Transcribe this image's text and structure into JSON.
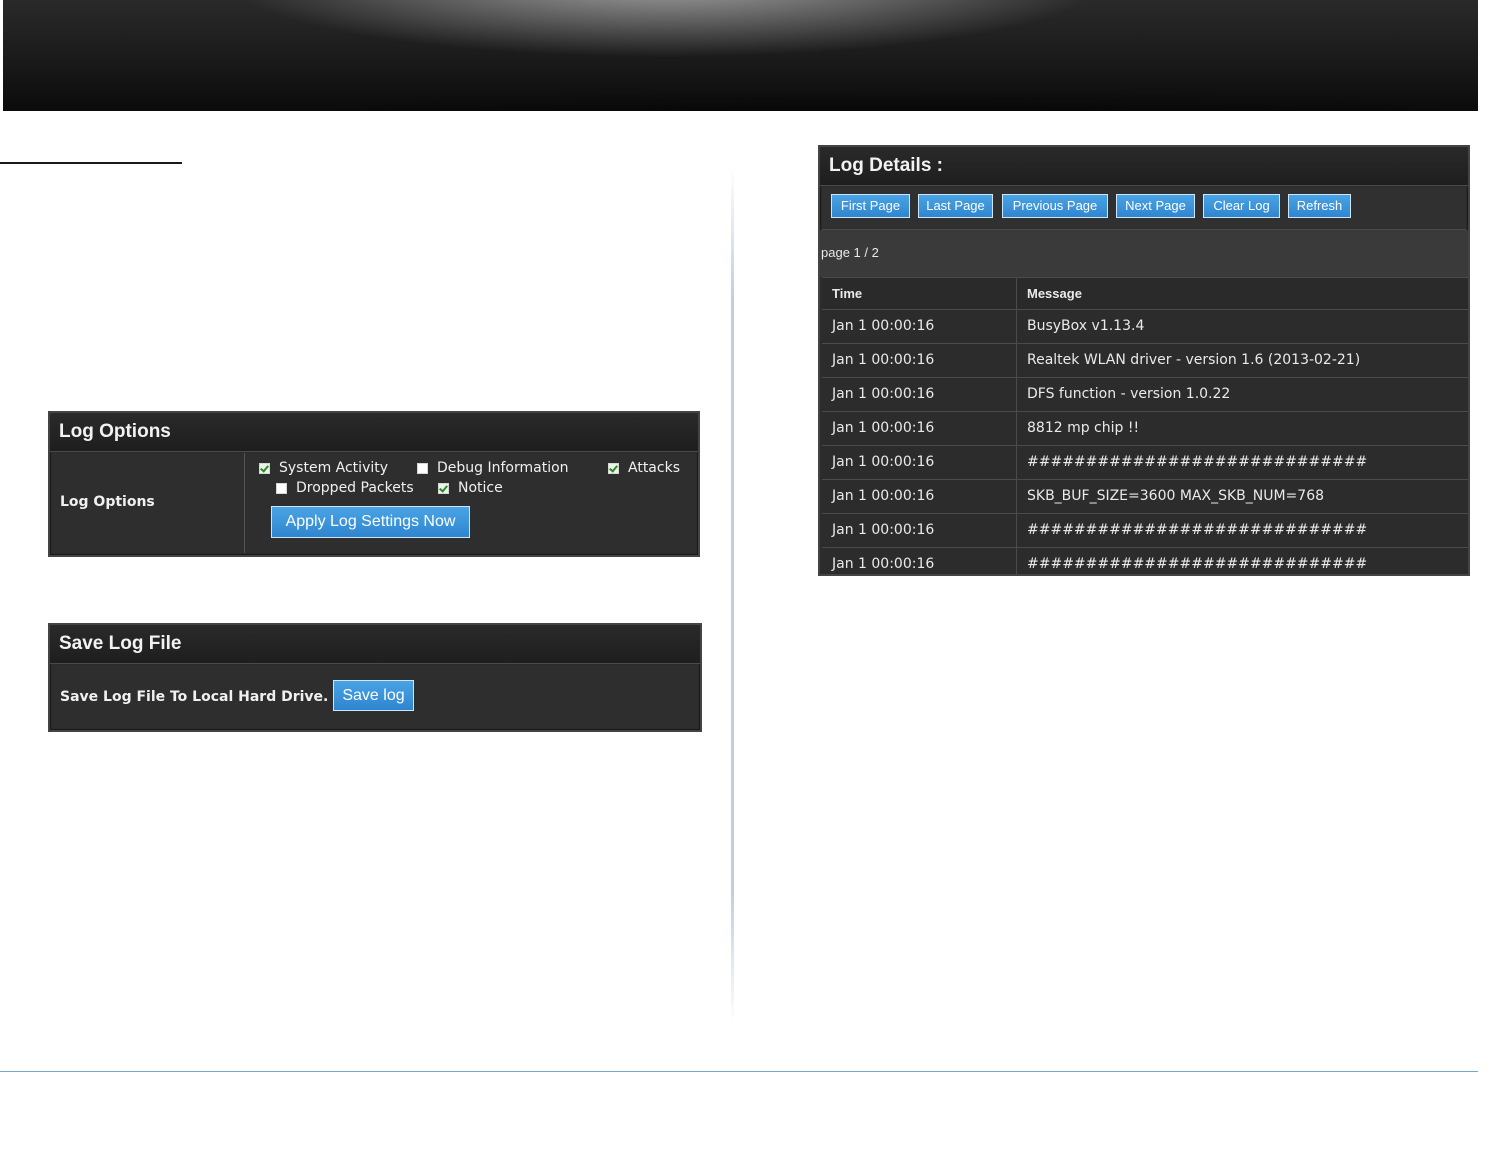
{
  "log_options": {
    "header": "Log Options",
    "row_label": "Log Options",
    "options": [
      {
        "label": "System Activity",
        "checked": true
      },
      {
        "label": "Debug Information",
        "checked": false
      },
      {
        "label": "Attacks",
        "checked": true
      },
      {
        "label": "Dropped Packets",
        "checked": false
      },
      {
        "label": "Notice",
        "checked": true
      }
    ],
    "apply_button": "Apply Log Settings Now"
  },
  "save_log": {
    "header": "Save Log File",
    "label": "Save Log File To Local Hard Drive.",
    "button": "Save log"
  },
  "log_details": {
    "header": "Log Details :",
    "buttons": {
      "first_page": "First Page",
      "last_page": "Last Page",
      "previous_page": "Previous Page",
      "next_page": "Next Page",
      "clear_log": "Clear Log",
      "refresh": "Refresh"
    },
    "page_indicator": "page 1 / 2",
    "columns": {
      "time": "Time",
      "message": "Message"
    },
    "rows": [
      {
        "time": "Jan 1 00:00:16",
        "message": "BusyBox v1.13.4"
      },
      {
        "time": "Jan 1 00:00:16",
        "message": "Realtek WLAN driver - version 1.6 (2013-02-21)"
      },
      {
        "time": "Jan 1 00:00:16",
        "message": "DFS function - version 1.0.22"
      },
      {
        "time": "Jan 1 00:00:16",
        "message": "8812 mp chip !!"
      },
      {
        "time": "Jan 1 00:00:16",
        "message": "#############################"
      },
      {
        "time": "Jan 1 00:00:16",
        "message": "SKB_BUF_SIZE=3600 MAX_SKB_NUM=768"
      },
      {
        "time": "Jan 1 00:00:16",
        "message": "#############################"
      },
      {
        "time": "Jan 1 00:00:16",
        "message": "#############################"
      }
    ]
  },
  "colors": {
    "button_blue": "#2f86d0",
    "panel_dark": "#2b2b2b",
    "accent_rule": "#7aa7c4"
  }
}
